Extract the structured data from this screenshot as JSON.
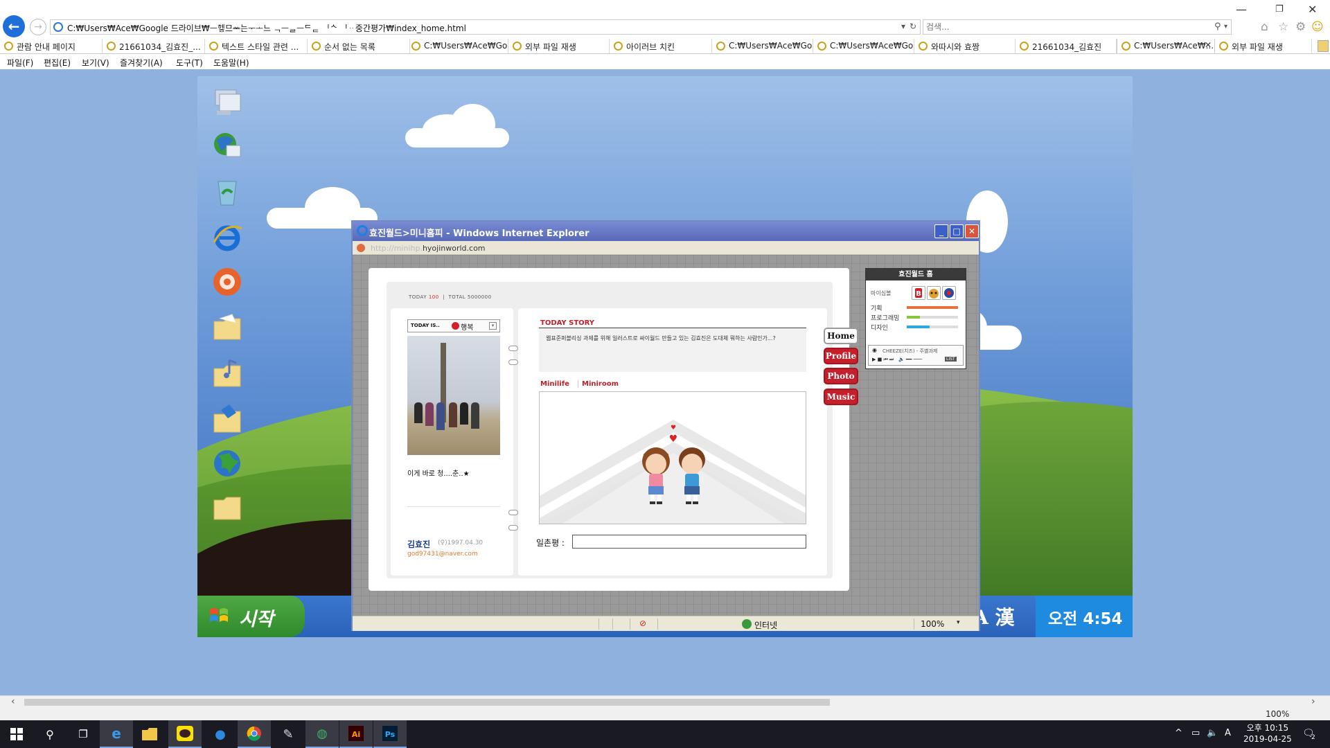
{
  "browser": {
    "address": "C:₩Users₩Ace₩Google 드라이브₩ᅳ헤ᇹ므ᆇ는ᅮᅩ느 ᆨᅳᆯᅳᄃᆮ ᅵᄾ ᅵᆢ중간평가₩index_home.html",
    "search_placeholder": "검색...",
    "tabs": [
      {
        "label": "관람 안내 페이지"
      },
      {
        "label": "21661034_김효진_..."
      },
      {
        "label": "텍스트 스타일 관련 ..."
      },
      {
        "label": "순서 없는 목록"
      },
      {
        "label": "C:₩Users₩Ace₩Goo..."
      },
      {
        "label": "외부 파일 재생"
      },
      {
        "label": "아이러브 치킨"
      },
      {
        "label": "C:₩Users₩Ace₩Goo..."
      },
      {
        "label": "C:₩Users₩Ace₩Goo..."
      },
      {
        "label": "와따시와 효짱"
      },
      {
        "label": "21661034_김효진"
      },
      {
        "label": "C:₩Users₩Ace₩..."
      },
      {
        "label": "외부 파일 재생"
      }
    ],
    "menu": [
      "파일(F)",
      "편집(E)",
      "보기(V)",
      "즐겨찾기(A)",
      "도구(T)",
      "도움말(H)"
    ],
    "zoom": "100%"
  },
  "desktop": {
    "start_label": "시작",
    "ime": "A 漢",
    "clock": "오전 4:54",
    "icons": [
      "my-computer-icon",
      "network-icon",
      "recycle-bin-icon",
      "internet-explorer-icon",
      "media-icon",
      "folder-icon",
      "music-folder-icon",
      "shared-folder-icon",
      "globe-icon",
      "folder-icon"
    ]
  },
  "inner_window": {
    "title": "효진월드>미니홈피 - Windows Internet Explorer",
    "url_prefix": "http://minihp.",
    "url_domain": "hyojinworld.com",
    "status_zone": "인터넷",
    "status_zoom": "100%"
  },
  "minihompy": {
    "counter": {
      "today_label": "TODAY",
      "today_value": "100",
      "total_label": "TOTAL",
      "total_value": "5000000"
    },
    "today_is": "TODAY IS..",
    "mood": "행복",
    "bio": "이게 바로 청....춘..★",
    "owner_name": "김효진",
    "owner_birth": "(♀)1997.04.30",
    "owner_email": "god97431@naver.com",
    "story_title": "TODAY STORY",
    "story_text": "웹표준퍼블리싱 과제를 위해 일러스트로 싸이월드 만들고 있는 김효진은 도대체 뭐하는 사람인가...?",
    "tab_minilife": "Minilife",
    "tab_miniroom": "Miniroom",
    "guest_label": "일촌평 :",
    "guest_value": "",
    "nav": [
      {
        "label": "Home",
        "active": true
      },
      {
        "label": "Profile",
        "active": false
      },
      {
        "label": "Photo",
        "active": false
      },
      {
        "label": "Music",
        "active": false
      }
    ],
    "side": {
      "title": "효진월드 홈",
      "my_symbol": "마이심볼",
      "skills": [
        {
          "label": "기획",
          "level": 1.0,
          "color": "#e8703a"
        },
        {
          "label": "프로그래밍",
          "level": 0.25,
          "color": "#8ac43f"
        },
        {
          "label": "디자인",
          "level": 0.45,
          "color": "#2fa9e1"
        }
      ],
      "track": "CHEEZE(치즈) - 주별과제",
      "list_label": "LIST"
    }
  },
  "win_taskbar": {
    "time": "오후 10:15",
    "date": "2019-04-25",
    "ime": "A",
    "notification_count": "2"
  }
}
